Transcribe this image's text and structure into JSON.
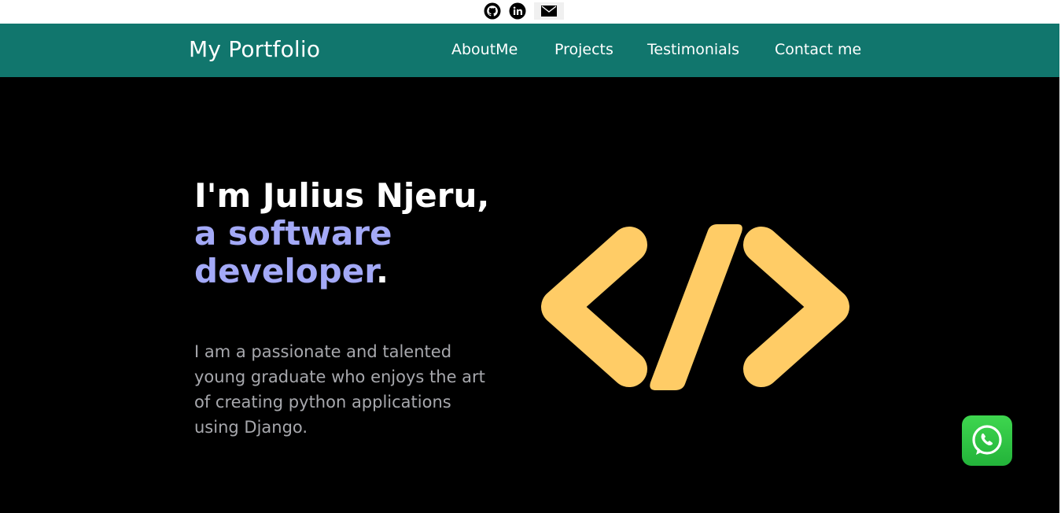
{
  "social": {
    "github_icon": "github-icon",
    "linkedin_icon": "linkedin-icon",
    "mail_icon": "mail-icon"
  },
  "navbar": {
    "brand": "My Portfolio",
    "items": [
      {
        "label": "AboutMe"
      },
      {
        "label": "Projects"
      },
      {
        "label": "Testimonials"
      },
      {
        "label": "Contact me"
      }
    ],
    "background": "#11766d"
  },
  "hero": {
    "headline_part1": "I'm Julius Njeru, ",
    "headline_accent": "a software developer",
    "headline_end": ".",
    "intro": "I am a passionate and talented young graduate who enjoys the art of creating python applications using Django.",
    "accent_color": "#a3a9f7",
    "logo_icon": "code-brackets-icon",
    "logo_color": "#ffcc66"
  },
  "whatsapp": {
    "icon": "whatsapp-icon",
    "color": "#2cc43f"
  }
}
